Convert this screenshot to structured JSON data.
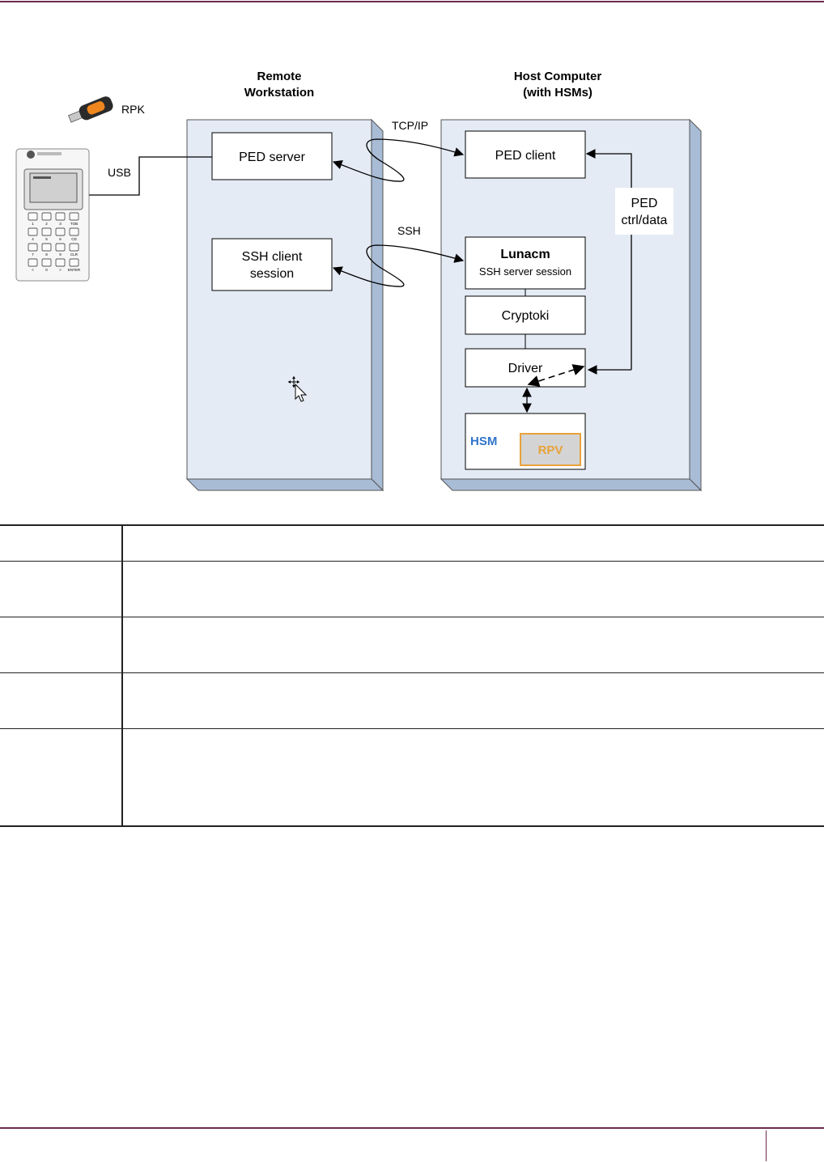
{
  "diagram": {
    "remote_title": [
      "Remote",
      "Workstation"
    ],
    "host_title": [
      "Host Computer",
      "(with HSMs)"
    ],
    "rpk_label": "RPK",
    "usb_label": "USB",
    "tcpip_label": "TCP/IP",
    "ssh_label": "SSH",
    "ped_server": "PED server",
    "ssh_client": [
      "SSH client",
      "session"
    ],
    "ped_client": "PED client",
    "ped_ctrl": [
      "PED",
      "ctrl/data"
    ],
    "lunacm": "Lunacm",
    "ssh_server": "SSH server session",
    "cryptoki": "Cryptoki",
    "driver": "Driver",
    "hsm": "HSM",
    "rpv": "RPV",
    "keypad_keys": [
      "1",
      "2",
      "3",
      "TOB",
      "4",
      "5",
      "6",
      "CD",
      "7",
      "8",
      "9",
      "CLR",
      "<",
      "0",
      ">",
      "ENTER"
    ],
    "colors": {
      "panel_fill": "#e4ebf5",
      "panel_side": "#a9bcd6",
      "hsm_blue": "#2f74c9",
      "rpv_orange": "#e8a23a",
      "rpv_fill": "#d4d4d4",
      "rule": "#6b2a4e"
    }
  },
  "table": {
    "rows": [
      {
        "c1": "",
        "c2": ""
      },
      {
        "c1": "",
        "c2": ""
      },
      {
        "c1": "",
        "c2": ""
      },
      {
        "c1": "",
        "c2": ""
      },
      {
        "c1": "",
        "c2": ""
      }
    ]
  }
}
